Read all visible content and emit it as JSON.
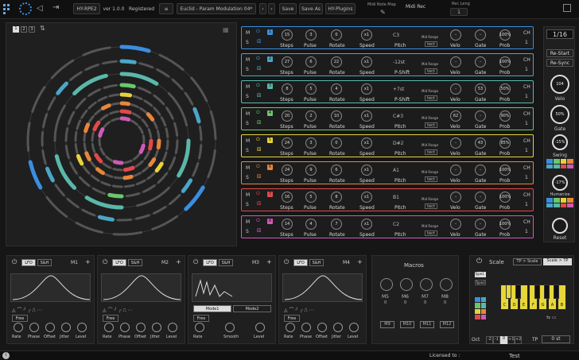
{
  "topbar": {
    "product": "HY-RPE2",
    "version": "ver 1.0.0",
    "registered": "Registered",
    "preset": "Euclid - Param Modulation 04*",
    "save": "Save",
    "save_as": "Save As",
    "plugins": "HY-Plugins",
    "midi_note_map": "Midi Note Map",
    "midi_rec": "Midi Rec",
    "rec_leng_label": "Rec Leng",
    "rec_leng": "1"
  },
  "circle": {
    "pages": [
      "1",
      "2",
      "3"
    ]
  },
  "tracks": [
    {
      "color": "#3a8ee0",
      "rate_type": "1",
      "steps": "15",
      "pulse": "3",
      "rotate": "0",
      "speed": "x1",
      "pitch": "C3",
      "aux": "D4",
      "velo": "-",
      "gate": "-",
      "prob": "100%",
      "ch": "1",
      "label_mode": "Pitch",
      "mid": "Mid Range",
      "detect": "tect"
    },
    {
      "color": "#4aa6c8",
      "rate_type": "2",
      "steps": "27",
      "pulse": "6",
      "rotate": "22",
      "speed": "x1",
      "pitch": "-12st",
      "aux": "",
      "velo": "-",
      "gate": "-",
      "prob": "100%",
      "ch": "1",
      "label_mode": "P-Shift",
      "mid": "Mid Range",
      "detect": "tect"
    },
    {
      "color": "#5ab8a8",
      "rate_type": "3",
      "steps": "8",
      "pulse": "5",
      "rotate": "4",
      "speed": "x1",
      "pitch": "+7st",
      "aux": "",
      "velo": "-",
      "gate": "53",
      "prob": "50%",
      "ch": "1",
      "label_mode": "P-Shift",
      "mid": "Mid Range",
      "detect": "tect"
    },
    {
      "color": "#6ac86a",
      "rate_type": "4",
      "steps": "20",
      "pulse": "2",
      "rotate": "10",
      "speed": "x1",
      "pitch": "C#3",
      "aux": "",
      "velo": "62",
      "gate": "-",
      "prob": "90%",
      "ch": "1",
      "label_mode": "Pitch",
      "mid": "Mid Range",
      "detect": "tect"
    },
    {
      "color": "#e8d23a",
      "rate_type": "5",
      "steps": "24",
      "pulse": "3",
      "rotate": "0",
      "speed": "x1",
      "pitch": "D#2",
      "aux": "",
      "velo": "-",
      "gate": "43",
      "prob": "85%",
      "ch": "1",
      "label_mode": "Pitch",
      "mid": "Mid Range",
      "detect": "tect"
    },
    {
      "color": "#e8863a",
      "rate_type": "6",
      "steps": "24",
      "pulse": "9",
      "rotate": "6",
      "speed": "x1",
      "pitch": "A1",
      "aux": "",
      "velo": "-",
      "gate": "-",
      "prob": "100%",
      "ch": "1",
      "label_mode": "Pitch",
      "mid": "Mid Range",
      "detect": "tect"
    },
    {
      "color": "#e04a4a",
      "rate_type": "7",
      "steps": "16",
      "pulse": "5",
      "rotate": "8",
      "speed": "x1",
      "pitch": "B1",
      "aux": "",
      "velo": "-",
      "gate": "-",
      "prob": "100%",
      "ch": "1",
      "label_mode": "Pitch",
      "mid": "Mid Range",
      "detect": "tect"
    },
    {
      "color": "#d05ab8",
      "rate_type": "8",
      "steps": "14",
      "pulse": "4",
      "rotate": "7",
      "speed": "x1",
      "pitch": "C2",
      "aux": "",
      "velo": "-",
      "gate": "-",
      "prob": "100%",
      "ch": "1",
      "label_mode": "Pitch",
      "mid": "Mid Range",
      "detect": "tect"
    }
  ],
  "track_labels": {
    "steps": "Steps",
    "pulse": "Pulse",
    "rotate": "Rotate",
    "speed": "Speed",
    "velo": "Velo",
    "gate": "Gate",
    "prob": "Prob",
    "ch": "CH",
    "m": "M",
    "s": "S"
  },
  "right": {
    "rate": "1/16",
    "restart_a": "Re-Start",
    "restart_b": "Re-Sync",
    "velo_val": "104",
    "velo": "Velo",
    "gate_val": "50%",
    "gate": "Gate",
    "swing_val": "-15%",
    "swing": "Swing",
    "humanize_val": "-17%",
    "humanize": "Humanize",
    "reset": "Reset"
  },
  "modulators": [
    {
      "name": "M1",
      "tab_a": "LFO",
      "tab_b": "S&H",
      "free": "Free",
      "k": [
        "Rate",
        "Phase",
        "Offset",
        "Jitter",
        "Level"
      ]
    },
    {
      "name": "M2",
      "tab_a": "LFO",
      "tab_b": "S&H",
      "free": "Free",
      "k": [
        "Rate",
        "Phase",
        "Offset",
        "Jitter",
        "Level"
      ]
    },
    {
      "name": "M3",
      "tab_a": "LFO",
      "tab_b": "S&H",
      "free": "Free",
      "mode1": "Mode1",
      "mode2": "Mode2",
      "k": [
        "Rate",
        "Smooth",
        "Level"
      ]
    },
    {
      "name": "M4",
      "tab_a": "LFO",
      "tab_b": "S&H",
      "free": "Free",
      "k": [
        "Rate",
        "Phase",
        "Offset",
        "Jitter",
        "Level"
      ]
    }
  ],
  "macros": {
    "title": "Macros",
    "row1": [
      "M5",
      "M6",
      "M7",
      "M8"
    ],
    "row1v": [
      "0",
      "0",
      "0",
      "0"
    ],
    "row2": [
      "M9",
      "M10",
      "M11",
      "M12"
    ]
  },
  "scale": {
    "title": "Scale",
    "tp_scale": "TP > Scale",
    "scale_tp": "Scale > TP",
    "type1": "Type1",
    "type2": "Type2",
    "keys": [
      "C",
      "D",
      "E",
      "F",
      "G",
      "A",
      "B"
    ],
    "oct": "Oct",
    "oct_vals": [
      "-2",
      "-1",
      "0",
      "+1",
      "+2"
    ],
    "tp": "TP",
    "tp_val": "0 st"
  },
  "footer": {
    "licensed": "Licensed to :",
    "user": "Test"
  }
}
